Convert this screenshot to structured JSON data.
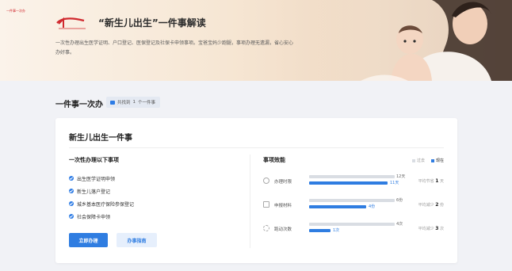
{
  "banner": {
    "logo_text": "一件事一次办",
    "title": "“新生儿出生”一件事解读",
    "description": "一次性办理出生医学证明、户口登记、医保登记及社保卡申领事项。宝爸宝妈少跑腿，事项办理无遗漏，省心安心办好事。"
  },
  "section": {
    "title": "一件事一次办",
    "found_prefix": "共找到",
    "found_count": "1",
    "found_suffix": "个一件事"
  },
  "card": {
    "title": "新生儿出生一件事",
    "left_title": "一次性办理以下事项",
    "items": [
      {
        "label": "出生医学证明申领"
      },
      {
        "label": "新生儿落户登记"
      },
      {
        "label": "城乡基本医疗保险参保登记"
      },
      {
        "label": "社会保障卡申领"
      }
    ],
    "primary_button": "立即办理",
    "secondary_button": "办事指南",
    "right_title": "事项效能",
    "legend": {
      "before": "过去",
      "now": "现在"
    },
    "metrics": [
      {
        "label": "办理时限",
        "before": 12,
        "now": 11,
        "unit": "天",
        "before_text": "12天",
        "now_text": "11天",
        "save_prefix": "平均节省",
        "save_value": "1",
        "save_unit": "天"
      },
      {
        "label": "申报材料",
        "before": 6,
        "now": 4,
        "unit": "份",
        "before_text": "6份",
        "now_text": "4份",
        "save_prefix": "平均减少",
        "save_value": "2",
        "save_unit": "份"
      },
      {
        "label": "跑动次数",
        "before": 4,
        "now": 1,
        "unit": "次",
        "before_text": "4次",
        "now_text": "1次",
        "save_prefix": "平均减少",
        "save_value": "3",
        "save_unit": "次"
      }
    ]
  },
  "colors": {
    "accent": "#2f7de1",
    "bar_before": "#d9dde3",
    "logo_red": "#d0282e"
  },
  "icons": [
    "logo-icon",
    "search-result-icon",
    "check-circle-icon",
    "clock-icon",
    "document-icon",
    "walk-icon"
  ]
}
